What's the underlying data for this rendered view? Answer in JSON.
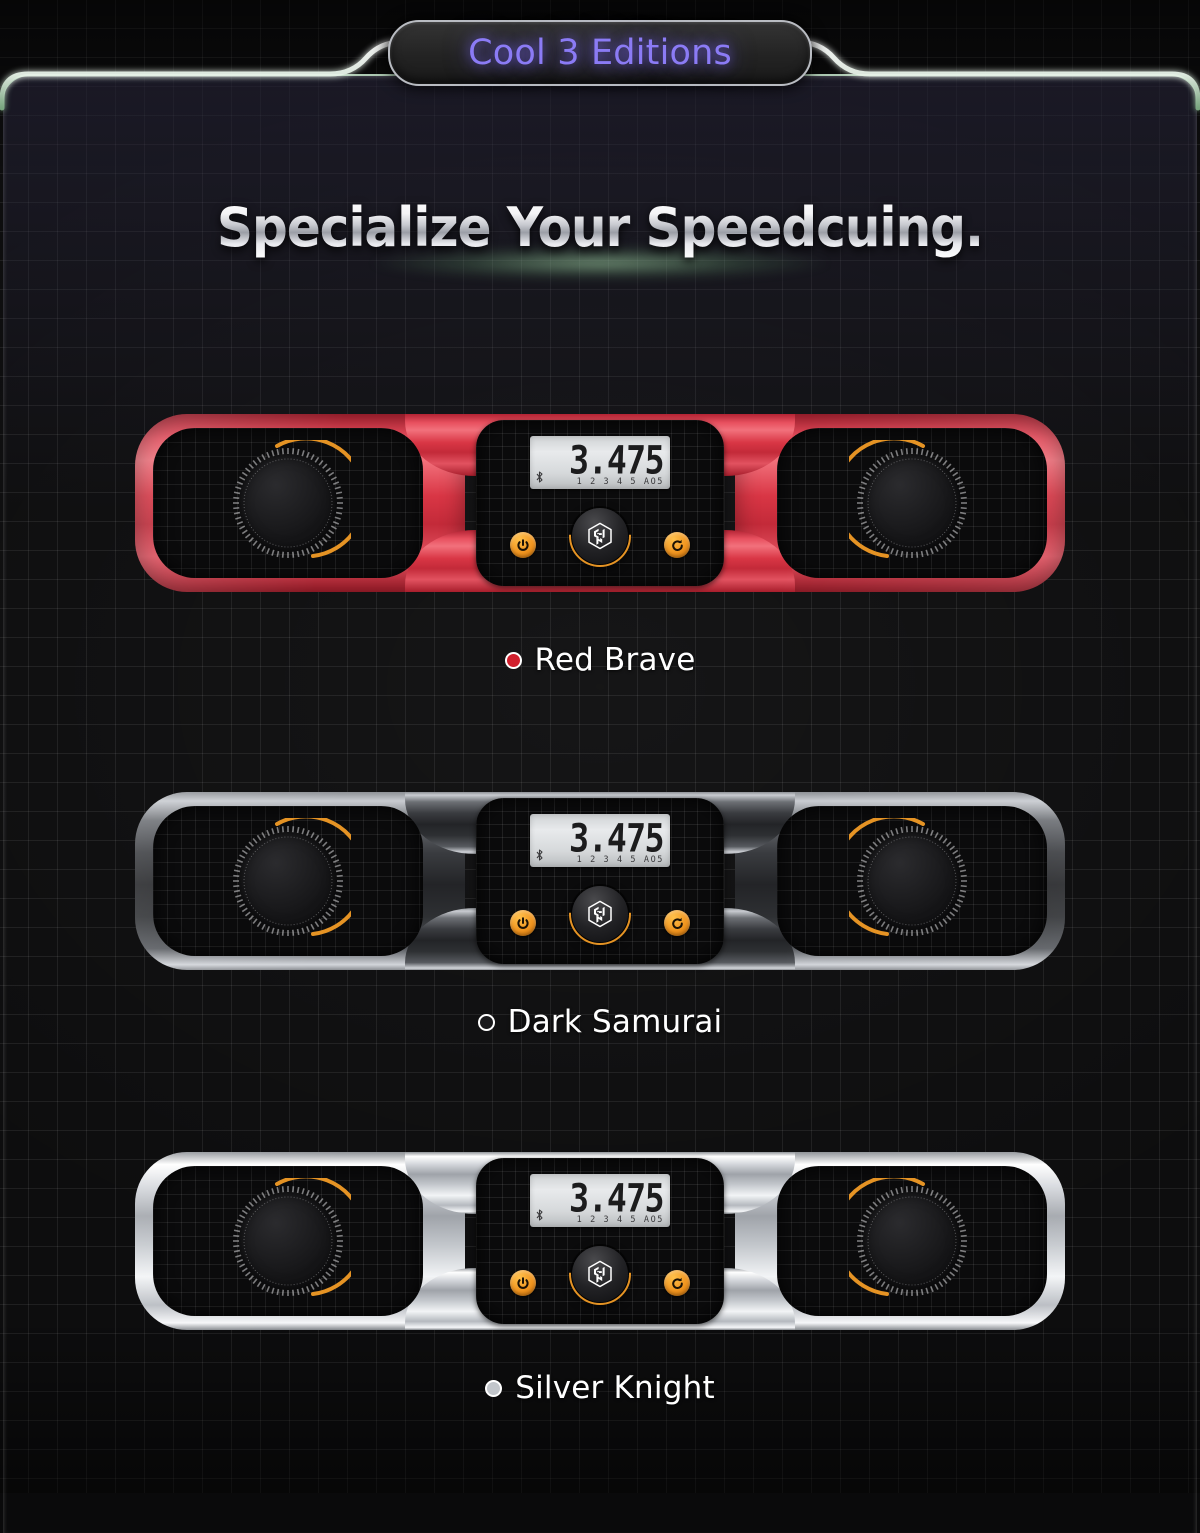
{
  "badge": {
    "label": "Cool 3 Editions",
    "text_color": "#8b7bf5"
  },
  "headline": {
    "text": "Specialize Your Speedcuing."
  },
  "devices": [
    {
      "id": "red-brave",
      "caption": "Red Brave",
      "dot_color": "#d11f2d",
      "body_color": "#d93645",
      "display": {
        "time": "3.475",
        "steps": "1 2 3 4 5 AO5",
        "bluetooth_icon": "bluetooth-icon"
      },
      "buttons": {
        "power": "power-icon",
        "gan_logo": "gan-cube-logo",
        "reset": "sync-icon"
      },
      "dials": {
        "left": "touch-dial-left",
        "right": "touch-dial-right"
      }
    },
    {
      "id": "dark-samurai",
      "caption": "Dark Samurai",
      "dot_color": "#1a1a1c",
      "body_color": "#3a3c40",
      "display": {
        "time": "3.475",
        "steps": "1 2 3 4 5 AO5",
        "bluetooth_icon": "bluetooth-icon"
      },
      "buttons": {
        "power": "power-icon",
        "gan_logo": "gan-cube-logo",
        "reset": "sync-icon"
      },
      "dials": {
        "left": "touch-dial-left",
        "right": "touch-dial-right"
      }
    },
    {
      "id": "silver-knight",
      "caption": "Silver Knight",
      "dot_color": "#c2c6cb",
      "body_color": "#d3d6db",
      "display": {
        "time": "3.475",
        "steps": "1 2 3 4 5 AO5",
        "bluetooth_icon": "bluetooth-icon"
      },
      "buttons": {
        "power": "power-icon",
        "gan_logo": "gan-cube-logo",
        "reset": "sync-icon"
      },
      "dials": {
        "left": "touch-dial-left",
        "right": "touch-dial-right"
      }
    }
  ],
  "accent": {
    "orange": "#e59324",
    "frame_glow": "#bee1c3"
  }
}
